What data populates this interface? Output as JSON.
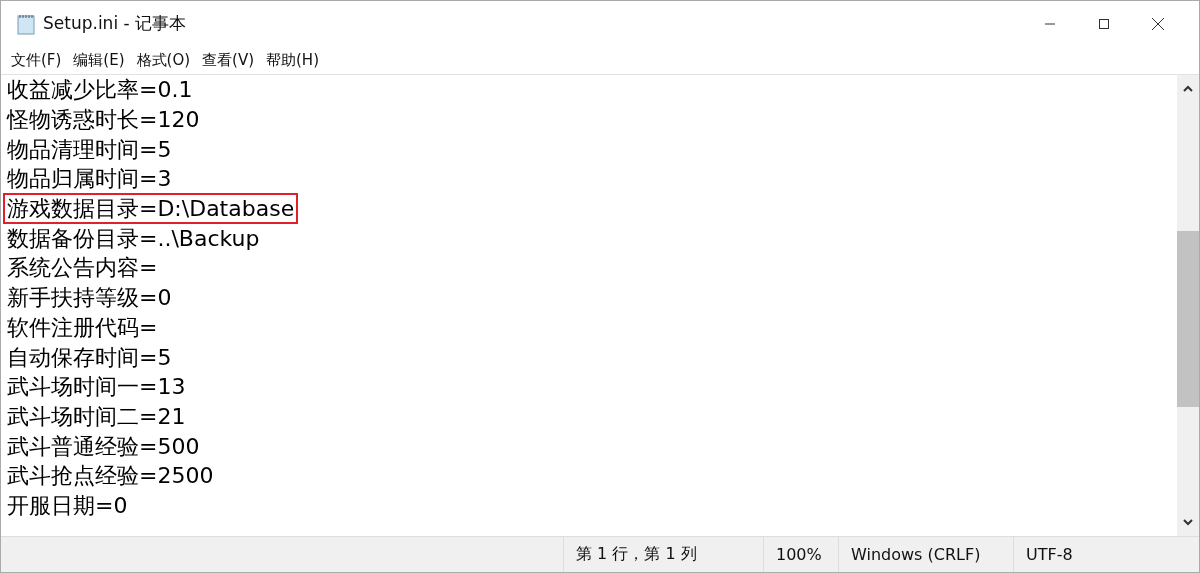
{
  "window": {
    "title": "Setup.ini - 记事本"
  },
  "menu": [
    "文件(F)",
    "编辑(E)",
    "格式(O)",
    "查看(V)",
    "帮助(H)"
  ],
  "lines": [
    {
      "text": "收益减少比率=0.1",
      "highlighted": false
    },
    {
      "text": "怪物诱惑时长=120",
      "highlighted": false
    },
    {
      "text": "物品清理时间=5",
      "highlighted": false
    },
    {
      "text": "物品归属时间=3",
      "highlighted": false
    },
    {
      "text": "游戏数据目录=D:\\Database",
      "highlighted": true
    },
    {
      "text": "数据备份目录=..\\Backup",
      "highlighted": false
    },
    {
      "text": "系统公告内容=",
      "highlighted": false
    },
    {
      "text": "新手扶持等级=0",
      "highlighted": false
    },
    {
      "text": "软件注册代码=",
      "highlighted": false
    },
    {
      "text": "自动保存时间=5",
      "highlighted": false
    },
    {
      "text": "武斗场时间一=13",
      "highlighted": false
    },
    {
      "text": "武斗场时间二=21",
      "highlighted": false
    },
    {
      "text": "武斗普通经验=500",
      "highlighted": false
    },
    {
      "text": "武斗抢点经验=2500",
      "highlighted": false
    },
    {
      "text": "开服日期=0",
      "highlighted": false
    }
  ],
  "status_bar": {
    "position": "第 1 行，第 1 列",
    "zoom": "100%",
    "line_ending": "Windows (CRLF)",
    "encoding": "UTF-8"
  }
}
